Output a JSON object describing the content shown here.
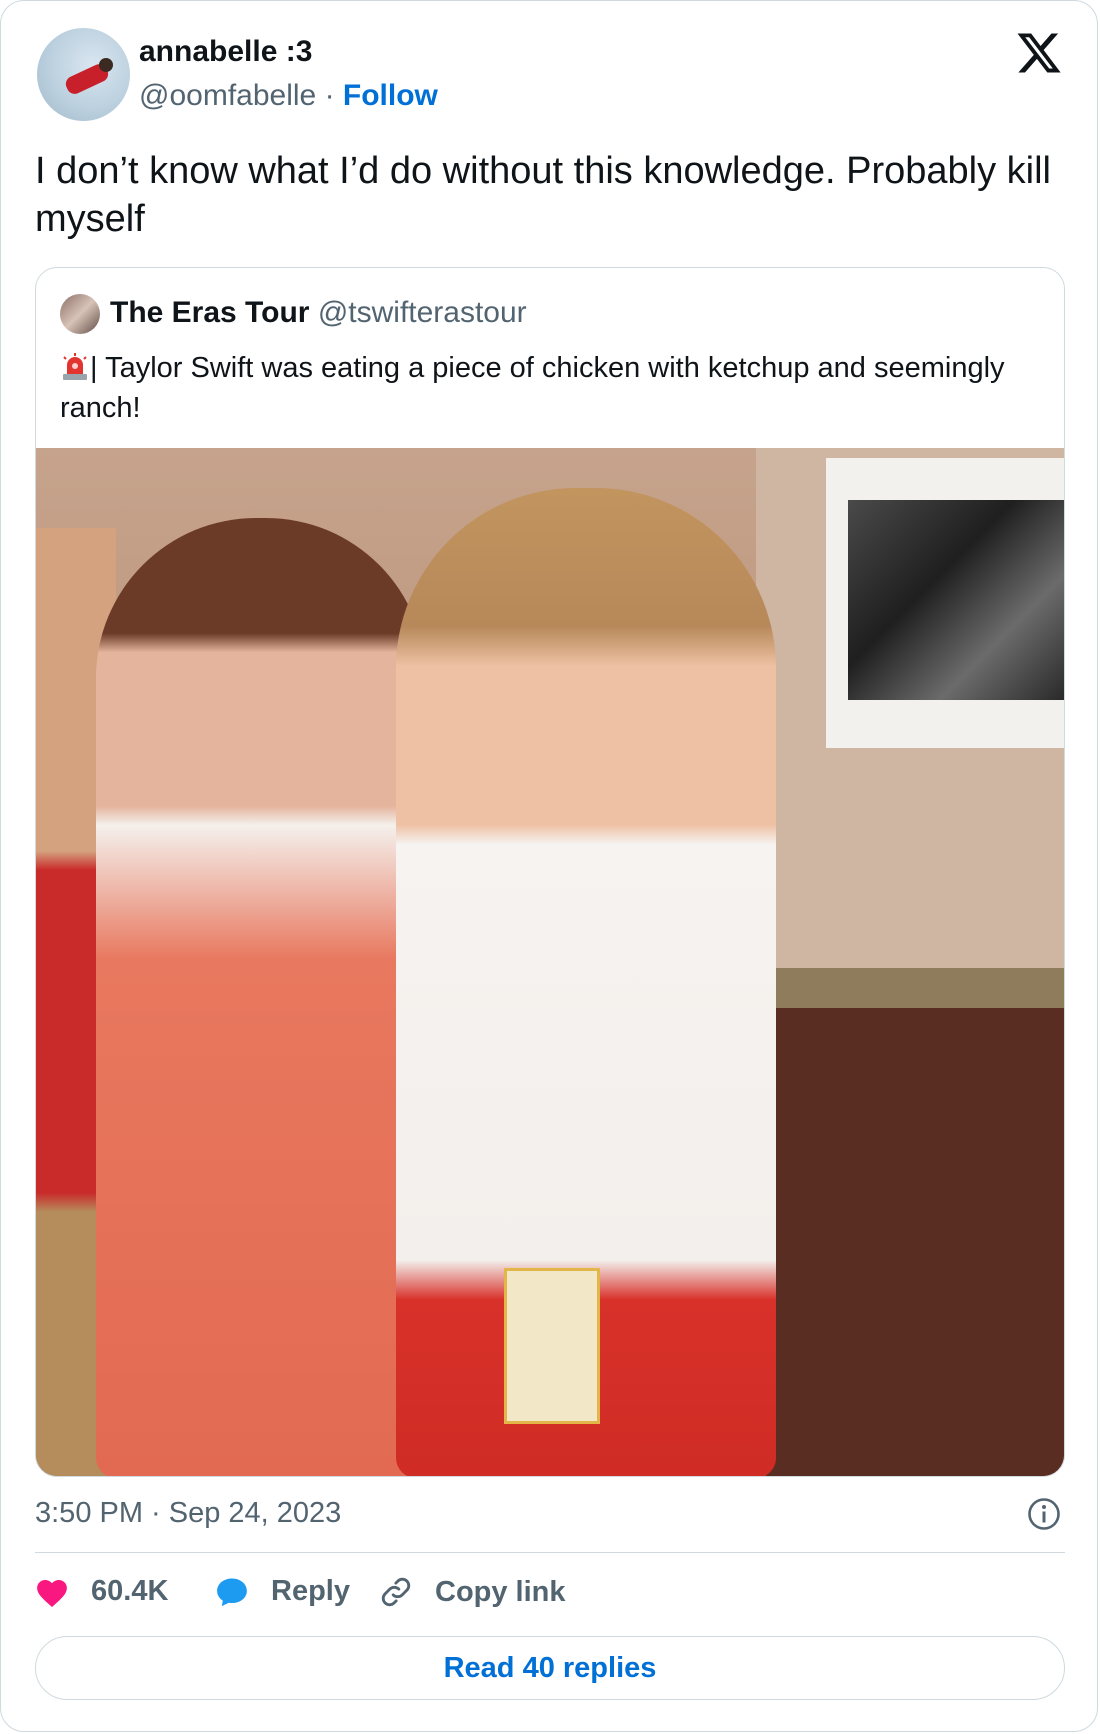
{
  "author": {
    "display_name": "annabelle :3",
    "handle": "@oomfabelle",
    "separator": "·",
    "follow_label": "Follow"
  },
  "tweet": {
    "text": "I don’t know what I’d do without this knowledge. Probably kill myself"
  },
  "quoted": {
    "display_name": "The Eras Tour",
    "handle": "@tswifterastour",
    "text": "| Taylor Swift was eating a piece of chicken with ketchup and seemingly ranch!"
  },
  "meta": {
    "timestamp": "3:50 PM · Sep 24, 2023"
  },
  "actions": {
    "like_count": "60.4K",
    "reply_label": "Reply",
    "copy_label": "Copy link",
    "read_replies_label": "Read 40 replies"
  },
  "colors": {
    "accent": "#006fd6",
    "like": "#f91880",
    "secondary_text": "#536471",
    "border": "#cfd9de"
  },
  "icons": {
    "brand": "x-logo-icon",
    "like": "heart-icon",
    "reply": "speech-bubble-icon",
    "copy": "link-icon",
    "info": "info-icon",
    "siren": "siren-emoji-icon"
  }
}
